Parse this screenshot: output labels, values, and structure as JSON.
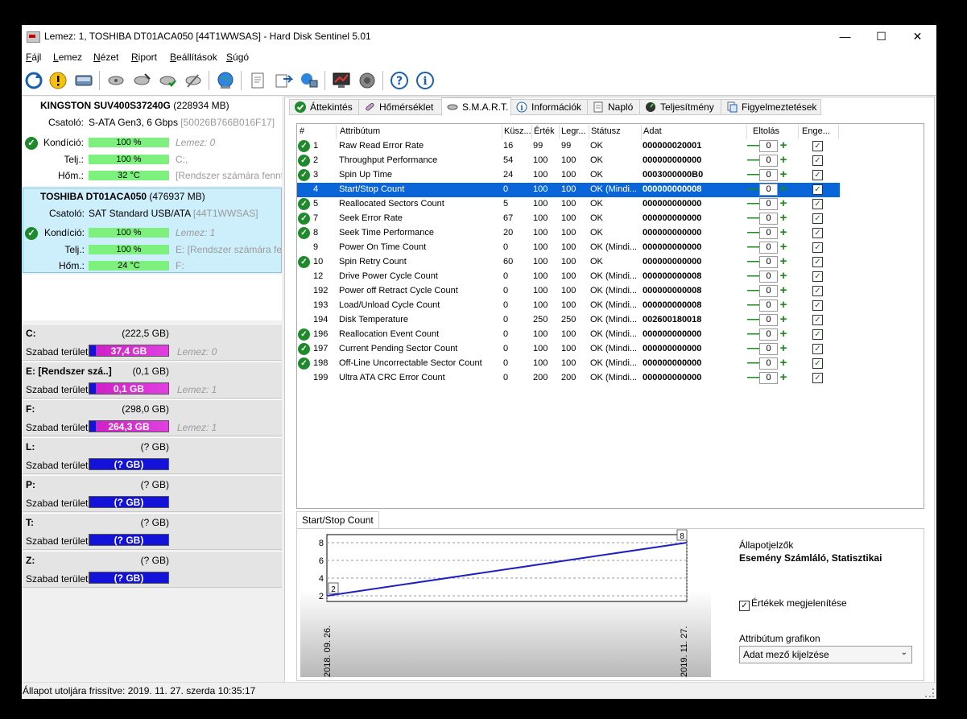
{
  "window": {
    "title": "Lemez: 1, TOSHIBA DT01ACA050 [44T1WWSAS]  -  Hard Disk Sentinel 5.01"
  },
  "menu": [
    "Fájl",
    "Lemez",
    "Nézet",
    "Riport",
    "Beállítások",
    "Súgó"
  ],
  "disks": [
    {
      "name": "KINGSTON SUV400S37240G",
      "size": "(228934 MB)",
      "csatolo_label": "Csatoló:",
      "csatolo_value": "S-ATA Gen3, 6 Gbps",
      "csatolo_serial": "[50026B766B016F17]",
      "kondicio_label": "Kondíció:",
      "kondicio_value": "100 %",
      "kondicio_note": "Lemez: 0",
      "telj_label": "Telj.:",
      "telj_value": "100 %",
      "telj_note": "C:,",
      "hom_label": "Hőm.:",
      "hom_value": "32 °C",
      "hom_note": "[Rendszer számára fennt"
    },
    {
      "name": "TOSHIBA DT01ACA050",
      "size": "(476937 MB)",
      "csatolo_label": "Csatoló:",
      "csatolo_value": "SAT Standard USB/ATA",
      "csatolo_serial": "[44T1WWSAS]",
      "kondicio_label": "Kondíció:",
      "kondicio_value": "100 %",
      "kondicio_note": "Lemez: 1",
      "telj_label": "Telj.:",
      "telj_value": "100 %",
      "telj_note": "E: [Rendszer számára fenn",
      "hom_label": "Hőm.:",
      "hom_value": "24 °C",
      "hom_note": "F:"
    }
  ],
  "volumes": [
    {
      "letter": "C:",
      "size": "(222,5 GB)",
      "free_label": "Szabad terület",
      "free": "37,4 GB",
      "lemez": "Lemez: 0"
    },
    {
      "letter": "E: [Rendszer szá..]",
      "size": "(0,1 GB)",
      "free_label": "Szabad terület",
      "free": "0,1 GB",
      "lemez": "Lemez: 1"
    },
    {
      "letter": "F:",
      "size": "(298,0 GB)",
      "free_label": "Szabad terület",
      "free": "264,3 GB",
      "lemez": "Lemez: 1"
    },
    {
      "letter": "L:",
      "size": "(? GB)",
      "free_label": "Szabad terület",
      "free": "(? GB)",
      "lemez": ""
    },
    {
      "letter": "P:",
      "size": "(? GB)",
      "free_label": "Szabad terület",
      "free": "(? GB)",
      "lemez": ""
    },
    {
      "letter": "T:",
      "size": "(? GB)",
      "free_label": "Szabad terület",
      "free": "(? GB)",
      "lemez": ""
    },
    {
      "letter": "Z:",
      "size": "(? GB)",
      "free_label": "Szabad terület",
      "free": "(? GB)",
      "lemez": ""
    }
  ],
  "tabs": [
    "Áttekintés",
    "Hőmérséklet",
    "S.M.A.R.T.",
    "Információk",
    "Napló",
    "Teljesítmény",
    "Figyelmeztetések"
  ],
  "grid": {
    "headers": [
      "#",
      "Attribútum",
      "Küsz...",
      "Érték",
      "Legr...",
      "Státusz",
      "Adat",
      "Eltolás",
      "Enge..."
    ],
    "rows": [
      {
        "ok": true,
        "id": "1",
        "name": "Raw Read Error Rate",
        "thr": "16",
        "val": "99",
        "worst": "99",
        "status": "OK",
        "data": "000000020001",
        "offset": "0"
      },
      {
        "ok": true,
        "id": "2",
        "name": "Throughput Performance",
        "thr": "54",
        "val": "100",
        "worst": "100",
        "status": "OK",
        "data": "000000000000",
        "offset": "0"
      },
      {
        "ok": true,
        "id": "3",
        "name": "Spin Up Time",
        "thr": "24",
        "val": "100",
        "worst": "100",
        "status": "OK",
        "data": "0003000000B0",
        "offset": "0"
      },
      {
        "ok": false,
        "id": "4",
        "name": "Start/Stop Count",
        "thr": "0",
        "val": "100",
        "worst": "100",
        "status": "OK (Mindi...",
        "data": "000000000008",
        "offset": "0",
        "selected": true
      },
      {
        "ok": true,
        "id": "5",
        "name": "Reallocated Sectors Count",
        "thr": "5",
        "val": "100",
        "worst": "100",
        "status": "OK",
        "data": "000000000000",
        "offset": "0"
      },
      {
        "ok": true,
        "id": "7",
        "name": "Seek Error Rate",
        "thr": "67",
        "val": "100",
        "worst": "100",
        "status": "OK",
        "data": "000000000000",
        "offset": "0"
      },
      {
        "ok": true,
        "id": "8",
        "name": "Seek Time Performance",
        "thr": "20",
        "val": "100",
        "worst": "100",
        "status": "OK",
        "data": "000000000000",
        "offset": "0"
      },
      {
        "ok": false,
        "id": "9",
        "name": "Power On Time Count",
        "thr": "0",
        "val": "100",
        "worst": "100",
        "status": "OK (Mindi...",
        "data": "000000000000",
        "offset": "0"
      },
      {
        "ok": true,
        "id": "10",
        "name": "Spin Retry Count",
        "thr": "60",
        "val": "100",
        "worst": "100",
        "status": "OK",
        "data": "000000000000",
        "offset": "0"
      },
      {
        "ok": false,
        "id": "12",
        "name": "Drive Power Cycle Count",
        "thr": "0",
        "val": "100",
        "worst": "100",
        "status": "OK (Mindi...",
        "data": "000000000008",
        "offset": "0"
      },
      {
        "ok": false,
        "id": "192",
        "name": "Power off Retract Cycle Count",
        "thr": "0",
        "val": "100",
        "worst": "100",
        "status": "OK (Mindi...",
        "data": "000000000008",
        "offset": "0"
      },
      {
        "ok": false,
        "id": "193",
        "name": "Load/Unload Cycle Count",
        "thr": "0",
        "val": "100",
        "worst": "100",
        "status": "OK (Mindi...",
        "data": "000000000008",
        "offset": "0"
      },
      {
        "ok": false,
        "id": "194",
        "name": "Disk Temperature",
        "thr": "0",
        "val": "250",
        "worst": "250",
        "status": "OK (Mindi...",
        "data": "002600180018",
        "offset": "0"
      },
      {
        "ok": true,
        "id": "196",
        "name": "Reallocation Event Count",
        "thr": "0",
        "val": "100",
        "worst": "100",
        "status": "OK (Mindi...",
        "data": "000000000000",
        "offset": "0"
      },
      {
        "ok": true,
        "id": "197",
        "name": "Current Pending Sector Count",
        "thr": "0",
        "val": "100",
        "worst": "100",
        "status": "OK (Mindi...",
        "data": "000000000000",
        "offset": "0"
      },
      {
        "ok": true,
        "id": "198",
        "name": "Off-Line Uncorrectable Sector Count",
        "thr": "0",
        "val": "100",
        "worst": "100",
        "status": "OK (Mindi...",
        "data": "000000000000",
        "offset": "0"
      },
      {
        "ok": false,
        "id": "199",
        "name": "Ultra ATA CRC Error Count",
        "thr": "0",
        "val": "200",
        "worst": "200",
        "status": "OK (Mindi...",
        "data": "000000000000",
        "offset": "0"
      }
    ]
  },
  "graph": {
    "tab": "Start/Stop Count",
    "info_title": "Állapotjelzők",
    "info_bold": "Esemény Számláló, Statisztikai",
    "show_values_label": "Értékek megjelenítése",
    "attr_graph_label": "Attribútum grafikon",
    "attr_graph_select": "Adat mező kijelzése"
  },
  "chart_data": {
    "type": "line",
    "x": [
      "2018. 09. 26.",
      "2019. 11. 27."
    ],
    "series": [
      {
        "values": [
          2,
          8
        ]
      }
    ],
    "yticks": [
      "2",
      "4",
      "6",
      "8"
    ],
    "data_labels": [
      "2",
      "8"
    ],
    "ylim": [
      2,
      8
    ],
    "line_color": "#2020c0"
  },
  "statusbar": {
    "text": "Állapot utoljára frissítve: 2019. 11. 27. szerda 10:35:17"
  }
}
